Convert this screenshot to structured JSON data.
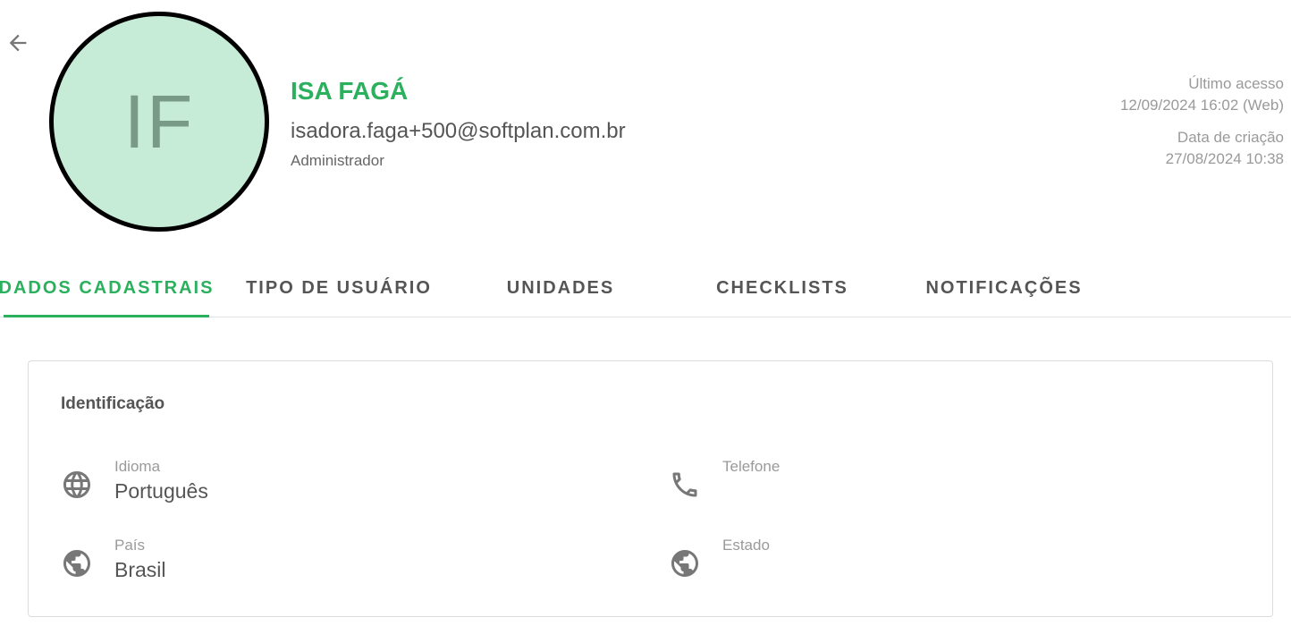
{
  "header": {
    "back_icon": "arrow-left-icon",
    "avatar_initials": "IF",
    "name": "ISA FAGÁ",
    "email": "isadora.faga+500@softplan.com.br",
    "role": "Administrador",
    "last_access_label": "Último acesso",
    "last_access_value": "12/09/2024 16:02 (Web)",
    "created_label": "Data de criação",
    "created_value": "27/08/2024 10:38"
  },
  "tabs": [
    {
      "label": "DADOS CADASTRAIS",
      "active": true
    },
    {
      "label": "TIPO DE USUÁRIO",
      "active": false
    },
    {
      "label": "UNIDADES",
      "active": false
    },
    {
      "label": "CHECKLISTS",
      "active": false
    },
    {
      "label": "NOTIFICAÇÕES",
      "active": false
    }
  ],
  "card": {
    "title": "Identificação",
    "fields": {
      "idioma": {
        "label": "Idioma",
        "value": "Português",
        "icon": "language-globe-icon"
      },
      "telefone": {
        "label": "Telefone",
        "value": "",
        "icon": "phone-icon"
      },
      "pais": {
        "label": "País",
        "value": "Brasil",
        "icon": "public-globe-icon"
      },
      "estado": {
        "label": "Estado",
        "value": "",
        "icon": "public-globe-icon"
      }
    }
  },
  "colors": {
    "accent": "#2bb05e",
    "avatar_bg": "#c6ebd7",
    "text": "#555555",
    "muted": "#9a9a9a"
  }
}
